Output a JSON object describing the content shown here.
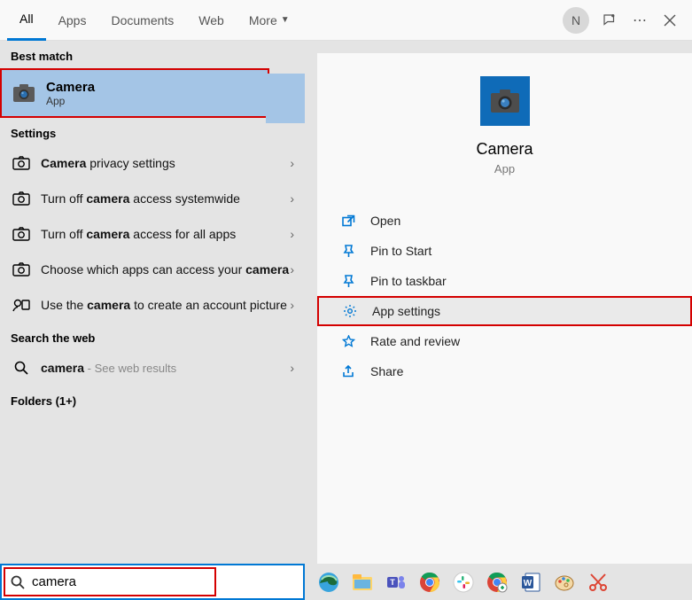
{
  "topbar": {
    "tabs": [
      "All",
      "Apps",
      "Documents",
      "Web",
      "More"
    ],
    "avatar_initial": "N"
  },
  "left": {
    "best_match_header": "Best match",
    "best_match": {
      "title": "Camera",
      "sub": "App"
    },
    "settings_header": "Settings",
    "settings": [
      {
        "pre": "",
        "b": "Camera",
        "post": " privacy settings"
      },
      {
        "pre": "Turn off ",
        "b": "camera",
        "post": " access systemwide"
      },
      {
        "pre": "Turn off ",
        "b": "camera",
        "post": " access for all apps"
      },
      {
        "pre": "Choose which apps can access your ",
        "b": "camera",
        "post": ""
      },
      {
        "pre": "Use the ",
        "b": "camera",
        "post": " to create an account picture"
      }
    ],
    "web_header": "Search the web",
    "web": {
      "b": "camera",
      "suffix": " - See web results"
    },
    "folders_header": "Folders (1+)"
  },
  "preview": {
    "title": "Camera",
    "sub": "App",
    "actions": [
      "Open",
      "Pin to Start",
      "Pin to taskbar",
      "App settings",
      "Rate and review",
      "Share"
    ]
  },
  "search": {
    "value": "camera"
  }
}
